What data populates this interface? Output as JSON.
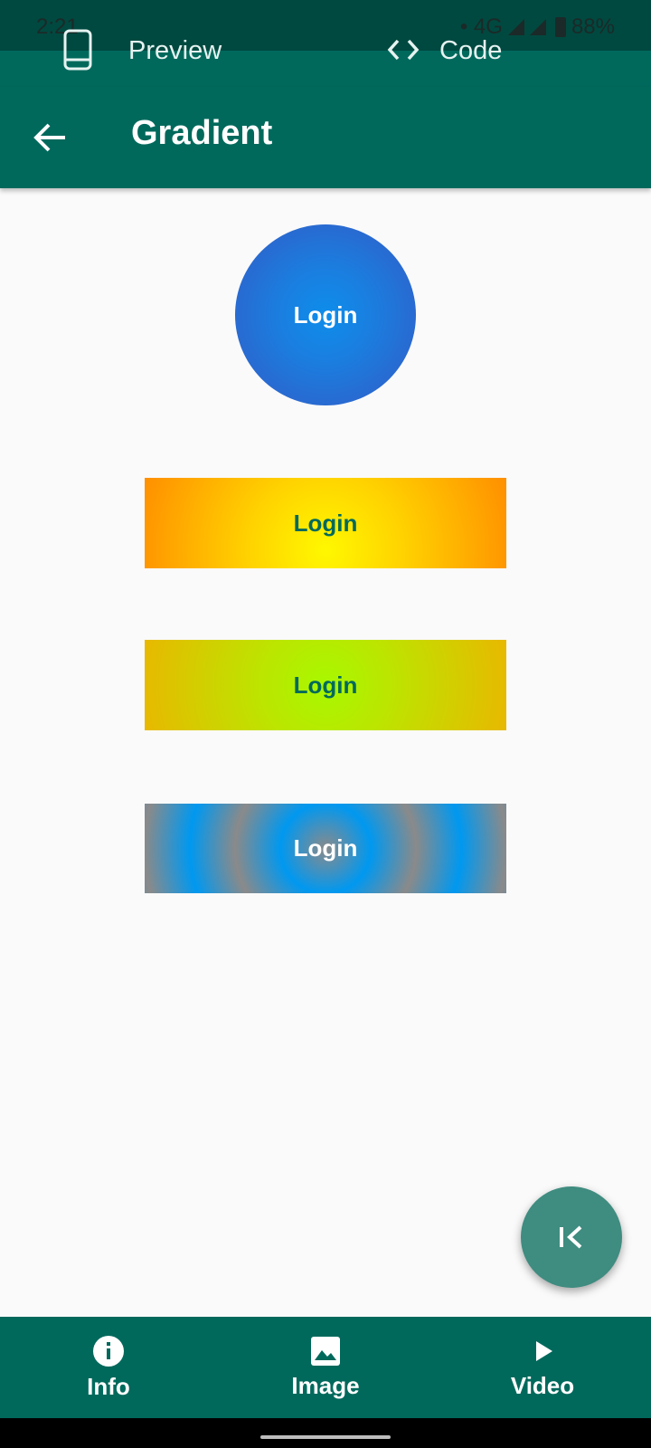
{
  "status": {
    "time": "2:21",
    "network": "• 4G",
    "battery": "88%"
  },
  "tabs": {
    "preview": "Preview",
    "code": "Code"
  },
  "appbar": {
    "title": "Gradient"
  },
  "buttons": {
    "circle": "Login",
    "yellow": "Login",
    "green": "Login",
    "blue": "Login"
  },
  "bottom_nav": {
    "info": "Info",
    "image": "Image",
    "video": "Video"
  },
  "colors": {
    "primary": "#00695C",
    "fab": "#3F8C80",
    "background": "#FAFAFA"
  }
}
